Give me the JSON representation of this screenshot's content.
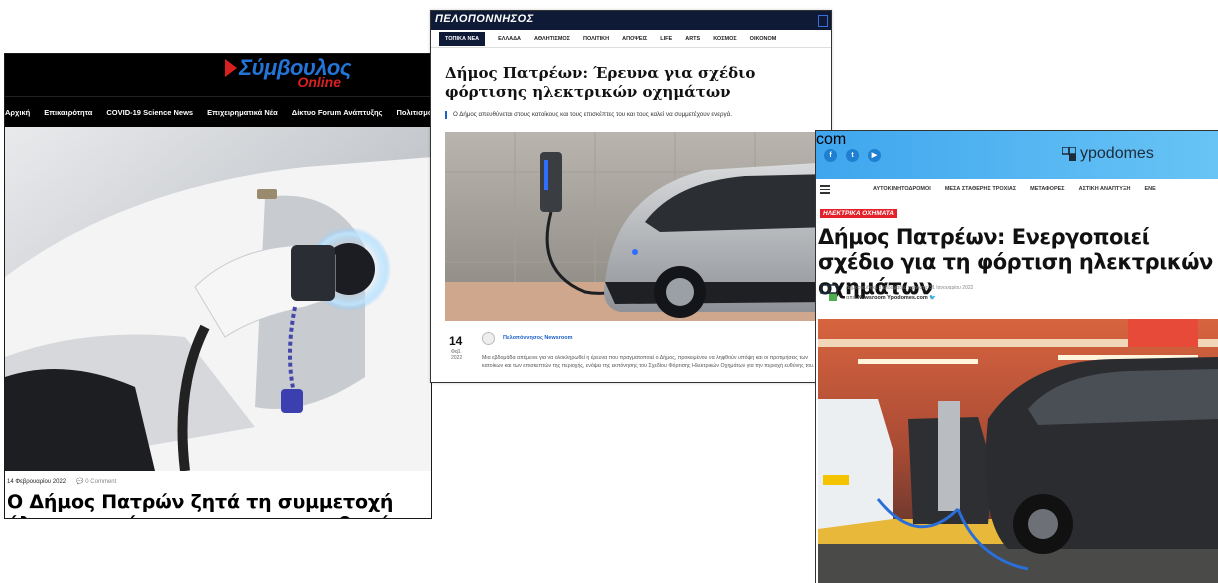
{
  "card1": {
    "logo_main": "Σύμβουλος",
    "logo_sub": "Online",
    "nav": [
      "Αρχική",
      "Επικαιρότητα",
      "COVID-19 Science News",
      "Επιχειρηματικά Νέα",
      "Δίκτυο Forum Ανάπτυξης",
      "Πολιτισμός"
    ],
    "date": "14 Φεβρουαρίου 2022",
    "comments": "0 Comment",
    "title": "Ο Δήμος Πατρών ζητά τη συμμετοχή όλων στην έρευνα για τους σταθμούς φόρτισης ηλεκτρικών αυτοκινήτων"
  },
  "card2": {
    "brand": "ΠΕΛΟΠΟΝΝΗΣΟΣ",
    "nav": [
      "ΤΟΠΙΚΑ ΝΕΑ",
      "ΕΛΛΑΔΑ",
      "ΑΘΛΗΤΙΣΜΟΣ",
      "ΠΟΛΙΤΙΚΗ",
      "ΑΠΟΨΕΙΣ",
      "LIFE",
      "ARTS",
      "ΚΟΣΜΟΣ",
      "ΟΙΚΟΝΟΜ"
    ],
    "title": "Δήμος Πατρέων: Έρευνα για σχέδιο φόρτισης ηλεκτρικών οχημάτων",
    "lead": "Ο Δήμος απευθύνεται στους κατοίκους και τους επισκέπτες του και τους καλεί να συμμετέχουν ενεργά.",
    "day": "14",
    "month": "Φεβ.",
    "year": "2022",
    "author": "Πελοπόννησος Newsroom",
    "body": "Μια εβδομάδα απέμεινε για να ολοκληρωθεί η έρευνα που πραγματοποιεί ο Δήμος, προκειμένου να ληφθούν υπόψη και οι προτιμήσεις των κατοίκων και των επισκεπτών της περιοχής, ενόψει της εκπόνησης του Σχεδίου Φόρτισης Ηλεκτρικών Οχημάτων για την περιοχή ευθύνης του."
  },
  "card3": {
    "logo": "ypodomes",
    "logo_com": "com",
    "social": [
      "f",
      "t",
      "▶"
    ],
    "nav": [
      "ΑΥΤΟΚΙΝΗΤΟΔΡΟΜΟΙ",
      "ΜΕΣΑ ΣΤΑΘΕΡΗΣ ΤΡΟΧΙΑΣ",
      "ΜΕΤΑΦΟΡΕΣ",
      "ΑΣΤΙΚΗ ΑΝΑΠΤΥΞΗ",
      "ΕΝΕ"
    ],
    "tag": "ΗΛΕΚΤΡΙΚΑ ΟΧΗΜΑΤΑ",
    "title": "Δήμος Πατρέων: Ενεργοποιεί σχέδιο για τη φόρτιση ηλεκτρικών οχημάτων",
    "published": "Δημοσιεύθηκε 3 εβδομάδες πριν στις 31 Ιανουαρίου 2022",
    "by_prefix": "από",
    "author": "Newsroom Ypodomes.com"
  },
  "colors": {
    "symvoulos_blue": "#2474d8",
    "symvoulos_red": "#d82020",
    "pelop_navy": "#0e1a36",
    "ypodomes_sky": "#3fa6ee",
    "tag_red": "#e4202a"
  }
}
